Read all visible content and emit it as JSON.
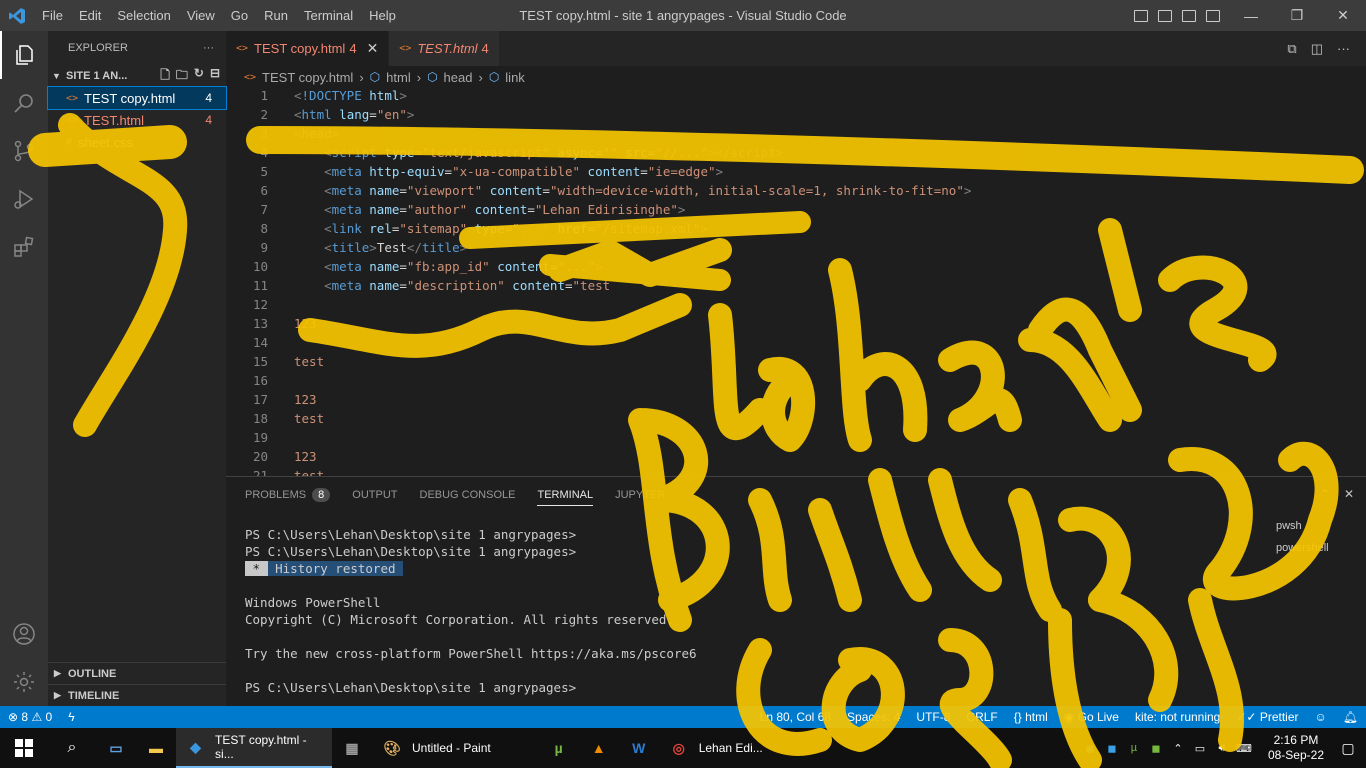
{
  "window": {
    "title": "TEST copy.html - site 1 angrypages - Visual Studio Code",
    "menu": [
      "File",
      "Edit",
      "Selection",
      "View",
      "Go",
      "Run",
      "Terminal",
      "Help"
    ],
    "controls": {
      "minimize": "—",
      "maximize": "❐",
      "close": "✕"
    }
  },
  "sidebar": {
    "header": "EXPLORER",
    "more": "···",
    "folder": "SITE 1 AN...",
    "files": [
      {
        "name": "TEST copy.html",
        "badge": "4",
        "icon": "<>"
      },
      {
        "name": "TEST.html",
        "badge": "4",
        "icon": "<>"
      },
      {
        "name": "sheet.css",
        "badge": "",
        "icon": "#"
      }
    ],
    "outline": "OUTLINE",
    "timeline": "TIMELINE"
  },
  "tabs": [
    {
      "label": "TEST copy.html",
      "count": "4",
      "close": "✕",
      "icon": "<>"
    },
    {
      "label": "TEST.html",
      "count": "4",
      "icon": "<>"
    }
  ],
  "breadcrumb": {
    "file": "TEST copy.html",
    "items": [
      "html",
      "head",
      "link"
    ],
    "sep": "›",
    "icon": "<>",
    "sym": "⬡"
  },
  "code": {
    "lines": [
      {
        "n": "1"
      },
      {
        "n": "2"
      },
      {
        "n": "3"
      },
      {
        "n": "4"
      },
      {
        "n": "5"
      },
      {
        "n": "6"
      },
      {
        "n": "7"
      },
      {
        "n": "8"
      },
      {
        "n": "9"
      },
      {
        "n": "10"
      },
      {
        "n": "11"
      },
      {
        "n": "12"
      },
      {
        "n": "13"
      },
      {
        "n": "14"
      },
      {
        "n": "15"
      },
      {
        "n": "16"
      },
      {
        "n": "17"
      },
      {
        "n": "18"
      },
      {
        "n": "19"
      },
      {
        "n": "20"
      },
      {
        "n": "21"
      }
    ]
  },
  "panel": {
    "tabs": [
      "PROBLEMS",
      "OUTPUT",
      "DEBUG CONSOLE",
      "TERMINAL",
      "JUPYTER"
    ],
    "problems_count": "8",
    "active": "TERMINAL",
    "terminal_lines": [
      "",
      "PS C:\\Users\\Lehan\\Desktop\\site 1 angrypages>",
      "PS C:\\Users\\Lehan\\Desktop\\site 1 angrypages>",
      "",
      "",
      "Windows PowerShell",
      "Copyright (C) Microsoft Corporation. All rights reserved.",
      "",
      "Try the new cross-platform PowerShell https://aka.ms/pscore6",
      "",
      "PS C:\\Users\\Lehan\\Desktop\\site 1 angrypages>"
    ],
    "history_star": " * ",
    "history_text": " History restored ",
    "side_labels": [
      "pwsh",
      "powershell"
    ]
  },
  "status": {
    "errors": "8",
    "warnings": "0",
    "position": "Ln 80, Col 68",
    "spaces": "Spaces: 4",
    "encoding": "UTF-8",
    "eol": "CRLF",
    "language": "html",
    "golive": "Go Live",
    "kite": "kite: not running",
    "prettier": "Prettier"
  },
  "taskbar": {
    "apps": [
      {
        "label": "TEST copy.html - si...",
        "icon": "vscode"
      },
      {
        "label": "",
        "icon": "calculator"
      },
      {
        "label": "Untitled - Paint",
        "icon": "paint"
      },
      {
        "label": "",
        "icon": "utorrent"
      },
      {
        "label": "",
        "icon": "vlc"
      },
      {
        "label": "",
        "icon": "word"
      },
      {
        "label": "Lehan Edi...",
        "icon": "chrome"
      }
    ],
    "time": "2:16 PM",
    "date": "08-Sep-22"
  },
  "colors": {
    "accent": "#007acc",
    "highlighter": "#f5c400",
    "error": "#f48771"
  }
}
